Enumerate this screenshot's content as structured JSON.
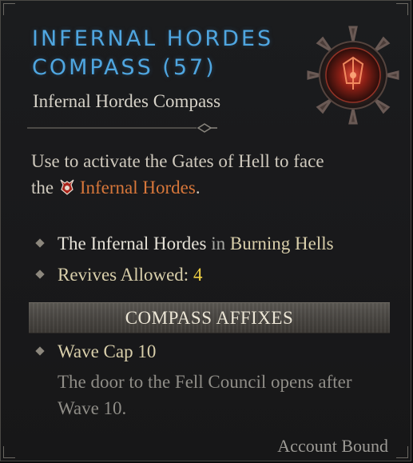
{
  "item": {
    "title_line1": "Infernal Hordes",
    "title_line2": "Compass (57)",
    "subtitle": "Infernal Hordes Compass",
    "description": {
      "part1": "Use to activate the Gates of Hell to face",
      "part2": "the",
      "highlight": "Infernal Hordes",
      "end": "."
    },
    "properties": [
      {
        "label": "The Infernal Hordes",
        "connector": "in",
        "value": "Burning Hells"
      },
      {
        "label": "Revives Allowed:",
        "value": "4"
      }
    ],
    "affix_section_header": "Compass Affixes",
    "affixes": [
      {
        "name": "Wave Cap 10",
        "description": "The door to the Fell Council opens after Wave 10."
      }
    ],
    "footer": "Account Bound"
  },
  "colors": {
    "title": "#4fa6e0",
    "highlight": "#d8773a",
    "value_yellow": "#f0d044",
    "affix_name": "#d9cfab"
  },
  "icons": {
    "item_image": "compass-item-icon",
    "inline_glyph": "infernal-hordes-icon",
    "bullet": "diamond-bullet-icon"
  }
}
